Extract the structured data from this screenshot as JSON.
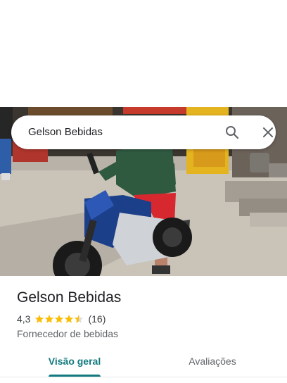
{
  "search": {
    "query": "Gelson Bebidas"
  },
  "place": {
    "name": "Gelson Bebidas",
    "rating": "4,3",
    "stars_value": 4.3,
    "review_count": "(16)",
    "category": "Fornecedor de bebidas"
  },
  "tabs": [
    {
      "label": "Visão geral",
      "selected": true
    },
    {
      "label": "Avaliações",
      "selected": false
    }
  ],
  "colors": {
    "accent": "#137a7f",
    "star": "#fbbc04"
  },
  "icons": {
    "search": "search-icon",
    "close": "close-icon",
    "star": "star-icon"
  }
}
